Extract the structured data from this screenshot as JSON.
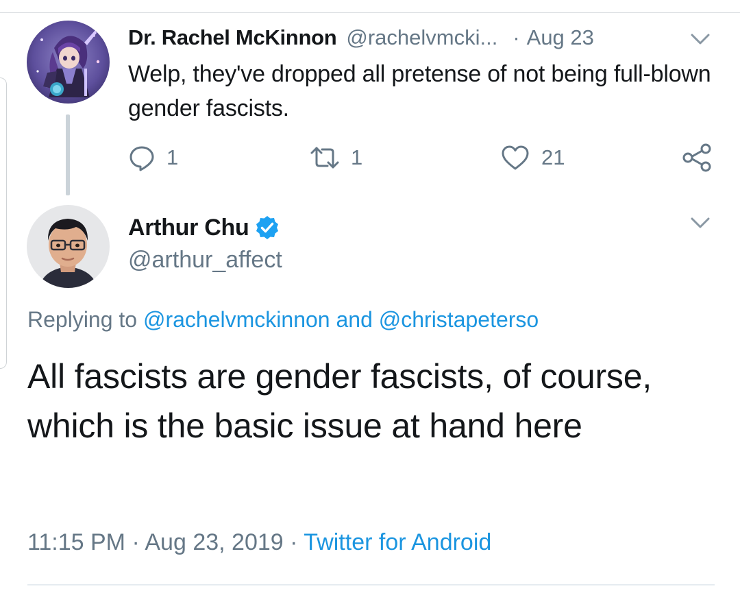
{
  "parent_tweet": {
    "display_name": "Dr. Rachel McKinnon",
    "handle": "@rachelvmcki...",
    "separator": "·",
    "date": "Aug 23",
    "text": "Welp, they've dropped all pretense of not being full-blown gender fascists.",
    "reply_count": "1",
    "retweet_count": "1",
    "like_count": "21",
    "avatar_icon": "anime-character-avatar"
  },
  "reply_tweet": {
    "display_name": "Arthur Chu",
    "verified": true,
    "verified_color": "#1da1f2",
    "handle": "@arthur_affect",
    "replying_prefix": "Replying to",
    "replying_user_1": "@rachelvmckinnon",
    "replying_and": "and",
    "replying_user_2": "@christapeterso",
    "text": "All fascists are gender fascists, of course, which is the basic issue at hand here",
    "time": "11:15 PM",
    "separator": "·",
    "date": "Aug 23, 2019",
    "source": "Twitter for Android",
    "avatar_icon": "person-photo-avatar"
  },
  "colors": {
    "text_primary": "#14171a",
    "text_secondary": "#657786",
    "link": "#1b95e0",
    "thread_line": "#cbd3d9"
  }
}
